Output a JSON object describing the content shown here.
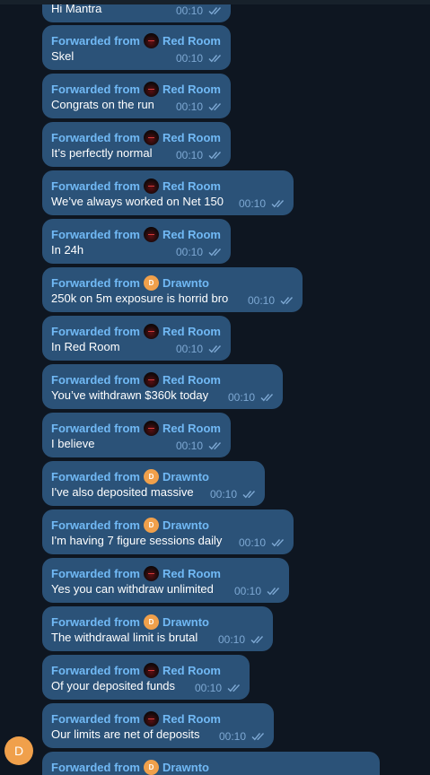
{
  "labels": {
    "forwarded_from": "Forwarded from",
    "sender_initial": "D"
  },
  "sources": {
    "red_room": "Red Room",
    "drawnto": "Drawnto",
    "drawnto_initial": "D"
  },
  "colors": {
    "background": "#0e1621",
    "bubble": "#2b5278",
    "forward_label": "#71b9f5",
    "time": "#7da8d3",
    "drawnto_avatar": "#f0a04b"
  },
  "messages": [
    {
      "source": "",
      "text": "Hi Mantra",
      "time": "00:10",
      "status": "read"
    },
    {
      "source": "Red Room",
      "text": "Skel",
      "time": "00:10",
      "status": "read"
    },
    {
      "source": "Red Room",
      "text": "Congrats on the run",
      "time": "00:10",
      "status": "read"
    },
    {
      "source": "Red Room",
      "text": "It’s perfectly normal",
      "time": "00:10",
      "status": "read"
    },
    {
      "source": "Red Room",
      "text": "We’ve always worked on Net 150",
      "time": "00:10",
      "status": "read"
    },
    {
      "source": "Red Room",
      "text": "In 24h",
      "time": "00:10",
      "status": "read"
    },
    {
      "source": "Drawnto",
      "text": "250k on 5m exposure is horrid bro",
      "time": "00:10",
      "status": "read"
    },
    {
      "source": "Red Room",
      "text": "In Red Room",
      "time": "00:10",
      "status": "read"
    },
    {
      "source": "Red Room",
      "text": "You’ve withdrawn $360k today",
      "time": "00:10",
      "status": "read"
    },
    {
      "source": "Red Room",
      "text": "I believe",
      "time": "00:10",
      "status": "read"
    },
    {
      "source": "Drawnto",
      "text": "I've also deposited massive",
      "time": "00:10",
      "status": "read"
    },
    {
      "source": "Drawnto",
      "text": "I'm having 7 figure sessions daily",
      "time": "00:10",
      "status": "read"
    },
    {
      "source": "Red Room",
      "text": "Yes you can withdraw unlimited",
      "time": "00:10",
      "status": "read"
    },
    {
      "source": "Drawnto",
      "text": "The withdrawal limit is brutal",
      "time": "00:10",
      "status": "read"
    },
    {
      "source": "Red Room",
      "text": "Of your deposited funds",
      "time": "00:10",
      "status": "read"
    },
    {
      "source": "Red Room",
      "text": "Our limits are net of deposits",
      "time": "00:10",
      "status": "read"
    },
    {
      "source": "Drawnto",
      "text": "",
      "time": "",
      "status": ""
    }
  ]
}
